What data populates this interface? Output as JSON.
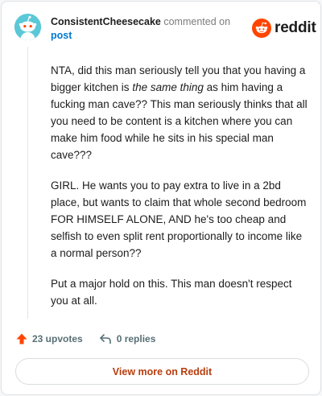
{
  "header": {
    "username": "ConsistentCheesecake",
    "commented_text": "commented on",
    "post_link": "post"
  },
  "logo": {
    "wordmark": "reddit"
  },
  "comment": {
    "p1_before": "NTA, did this man seriously tell you that you having a bigger kitchen is ",
    "p1_italic": "the same thing",
    "p1_after": " as him having a fucking man cave?? This man seriously thinks that all you need to be content is a kitchen where you can make him food while he sits in his special man cave???",
    "p2": "GIRL. He wants you to pay extra to live in a 2bd place, but wants to claim that whole second bedroom FOR HIMSELF ALONE, AND he's too cheap and selfish to even split rent proportionally to income like a normal person??",
    "p3": "Put a major hold on this. This man doesn't respect you at all."
  },
  "actions": {
    "upvotes": "23 upvotes",
    "replies": "0 replies"
  },
  "view_more_label": "View more on Reddit",
  "colors": {
    "accent": "#ff4500",
    "link": "#0079d3",
    "view_more_text": "#b83d0e",
    "avatar_bg": "#5bc8d7"
  },
  "icons": {
    "avatar": "snoo-avatar",
    "logo": "reddit-logo-icon",
    "upvote": "upvote-arrow-icon",
    "reply": "reply-arrow-icon"
  }
}
